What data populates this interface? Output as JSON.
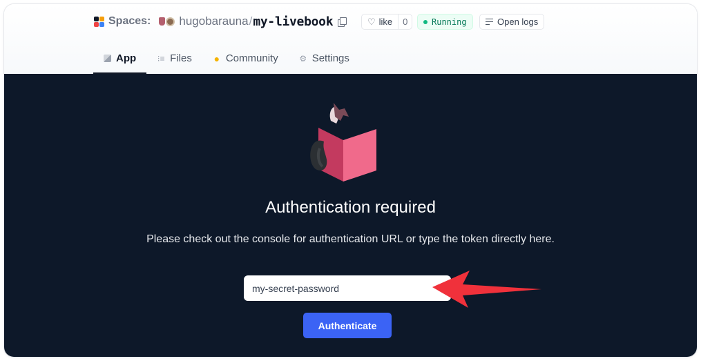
{
  "header": {
    "brand_label": "Spaces:",
    "owner": "hugobarauna",
    "separator": "/",
    "repo_name": "my-livebook",
    "like_label": "like",
    "like_count": "0",
    "status": "Running",
    "logs_label": "Open logs"
  },
  "tabs": [
    {
      "label": "App",
      "icon": "cube-icon",
      "active": true
    },
    {
      "label": "Files",
      "icon": "files-icon",
      "active": false
    },
    {
      "label": "Community",
      "icon": "hands-icon",
      "active": false
    },
    {
      "label": "Settings",
      "icon": "gear-icon",
      "active": false
    }
  ],
  "app": {
    "title": "Authentication required",
    "description": "Please check out the console for authentication URL or type the token directly here.",
    "token_value": "my-secret-password",
    "button_label": "Authenticate"
  },
  "colors": {
    "panel_bg": "#0d1829",
    "button_bg": "#3b63f5",
    "status_green": "#10b981",
    "arrow_red": "#f0313b"
  }
}
